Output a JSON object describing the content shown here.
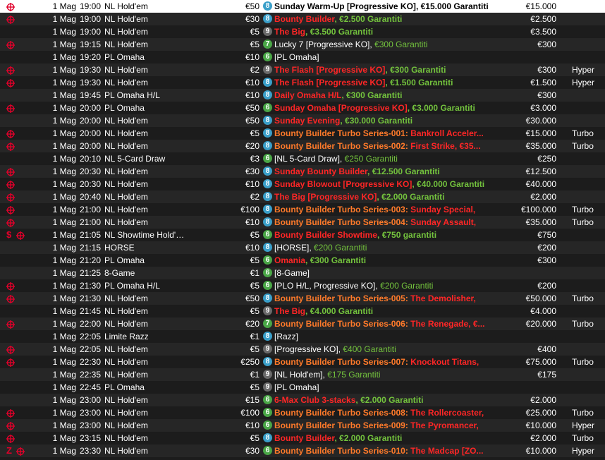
{
  "icons": {
    "target": "crosshair-target-icon",
    "dollar": "dollar-sign-icon",
    "badge": "table-size-badge"
  },
  "colors": {
    "row_alt": "#262626",
    "row_bg": "#1c1c1c",
    "selected": "#ffffff",
    "red": "#ff2626",
    "orange": "#ff7a2a",
    "green": "#73c23d",
    "badge_blue": "#3a9fc9",
    "badge_green": "#49a646",
    "badge_gray": "#6a6a6a"
  },
  "rows": [
    {
      "icons": [
        "target"
      ],
      "date": "1 Mag",
      "time": "19:00",
      "game": "NL Hold'em",
      "buyin": "€50",
      "badge": "8",
      "name": "Sunday Warm-Up [Progressive KO]",
      "tail": "",
      "gtd": "€15.000 Garantiti",
      "guarantee": "€15.000",
      "speed": "",
      "style": "selected"
    },
    {
      "icons": [
        "target"
      ],
      "date": "1 Mag",
      "time": "19:00",
      "game": "NL Hold'em",
      "buyin": "€30",
      "badge": "8",
      "name": "Bounty Builder",
      "tail": "",
      "gtd": "€2.500 Garantiti",
      "guarantee": "€2.500",
      "speed": "",
      "style": "red"
    },
    {
      "icons": [],
      "date": "1 Mag",
      "time": "19:00",
      "game": "NL Hold'em",
      "buyin": "€5",
      "badge": "9",
      "name": "The Big",
      "tail": "",
      "gtd": "€3.500 Garantiti",
      "guarantee": "€3.500",
      "speed": "",
      "style": "red"
    },
    {
      "icons": [
        "target"
      ],
      "date": "1 Mag",
      "time": "19:15",
      "game": "NL Hold'em",
      "buyin": "€5",
      "badge": "7",
      "name": "Lucky 7 [Progressive KO]",
      "tail": "",
      "gtd": "€300 Garantiti",
      "guarantee": "€300",
      "speed": "",
      "style": "white"
    },
    {
      "icons": [],
      "date": "1 Mag",
      "time": "19:20",
      "game": "PL Omaha",
      "buyin": "€10",
      "badge": "6",
      "name": "[PL Omaha]",
      "tail": "",
      "gtd": "",
      "guarantee": "",
      "speed": "",
      "style": "white"
    },
    {
      "icons": [
        "target"
      ],
      "date": "1 Mag",
      "time": "19:30",
      "game": "NL Hold'em",
      "buyin": "€2",
      "badge": "9",
      "name": "The Flash [Progressive KO]",
      "tail": "",
      "gtd": "€300 Garantiti",
      "guarantee": "€300",
      "speed": "Hyper",
      "style": "red"
    },
    {
      "icons": [
        "target"
      ],
      "date": "1 Mag",
      "time": "19:30",
      "game": "NL Hold'em",
      "buyin": "€10",
      "badge": "8",
      "name": "The Flash [Progressive KO]",
      "tail": "",
      "gtd": "€1.500 Garantiti",
      "guarantee": "€1.500",
      "speed": "Hyper",
      "style": "red"
    },
    {
      "icons": [],
      "date": "1 Mag",
      "time": "19:45",
      "game": "PL Omaha H/L",
      "buyin": "€10",
      "badge": "8",
      "name": "Daily Omaha H/L",
      "tail": "",
      "gtd": "€300 Garantiti",
      "guarantee": "€300",
      "speed": "",
      "style": "red"
    },
    {
      "icons": [
        "target"
      ],
      "date": "1 Mag",
      "time": "20:00",
      "game": "PL Omaha",
      "buyin": "€50",
      "badge": "6",
      "name": "Sunday Omaha [Progressive KO]",
      "tail": "",
      "gtd": "€3.000 Garantiti",
      "guarantee": "€3.000",
      "speed": "",
      "style": "red"
    },
    {
      "icons": [],
      "date": "1 Mag",
      "time": "20:00",
      "game": "NL Hold'em",
      "buyin": "€50",
      "badge": "8",
      "name": "Sunday Evening",
      "tail": "",
      "gtd": "€30.000 Garantiti",
      "guarantee": "€30.000",
      "speed": "",
      "style": "red"
    },
    {
      "icons": [
        "target"
      ],
      "date": "1 Mag",
      "time": "20:00",
      "game": "NL Hold'em",
      "buyin": "€5",
      "badge": "8",
      "name": "Bounty Builder Turbo Series-001:",
      "tail": " Bankroll Acceler...",
      "gtd": "",
      "guarantee": "€15.000",
      "speed": "Turbo",
      "style": "orange"
    },
    {
      "icons": [
        "target"
      ],
      "date": "1 Mag",
      "time": "20:00",
      "game": "NL Hold'em",
      "buyin": "€20",
      "badge": "8",
      "name": "Bounty Builder Turbo Series-002:",
      "tail": " First Strike, €35...",
      "gtd": "",
      "guarantee": "€35.000",
      "speed": "Turbo",
      "style": "orange"
    },
    {
      "icons": [],
      "date": "1 Mag",
      "time": "20:10",
      "game": "NL 5-Card Draw",
      "buyin": "€3",
      "badge": "6",
      "name": "[NL 5-Card Draw]",
      "tail": "",
      "gtd": "€250 Garantiti",
      "guarantee": "€250",
      "speed": "",
      "style": "white"
    },
    {
      "icons": [
        "target"
      ],
      "date": "1 Mag",
      "time": "20:30",
      "game": "NL Hold'em",
      "buyin": "€30",
      "badge": "8",
      "name": "Sunday Bounty Builder",
      "tail": "",
      "gtd": "€12.500 Garantiti",
      "guarantee": "€12.500",
      "speed": "",
      "style": "red"
    },
    {
      "icons": [
        "target"
      ],
      "date": "1 Mag",
      "time": "20:30",
      "game": "NL Hold'em",
      "buyin": "€10",
      "badge": "8",
      "name": "Sunday Blowout [Progressive KO]",
      "tail": "",
      "gtd": "€40.000 Garantiti",
      "guarantee": "€40.000",
      "speed": "",
      "style": "red"
    },
    {
      "icons": [
        "target"
      ],
      "date": "1 Mag",
      "time": "20:40",
      "game": "NL Hold'em",
      "buyin": "€2",
      "badge": "8",
      "name": "The Big [Progressive KO]",
      "tail": "",
      "gtd": "€2.000 Garantiti",
      "guarantee": "€2.000",
      "speed": "",
      "style": "red"
    },
    {
      "icons": [
        "target"
      ],
      "date": "1 Mag",
      "time": "21:00",
      "game": "NL Hold'em",
      "buyin": "€100",
      "badge": "8",
      "name": "Bounty Builder Turbo Series-003:",
      "tail": " Sunday Special,",
      "gtd": "",
      "guarantee": "€100.000",
      "speed": "Turbo",
      "style": "orange"
    },
    {
      "icons": [
        "target"
      ],
      "date": "1 Mag",
      "time": "21:00",
      "game": "NL Hold'em",
      "buyin": "€10",
      "badge": "8",
      "name": "Bounty Builder Turbo Series-004:",
      "tail": " Sunday Assault,",
      "gtd": "",
      "guarantee": "€35.000",
      "speed": "Turbo",
      "style": "orange"
    },
    {
      "icons": [
        "dollar",
        "target"
      ],
      "date": "1 Mag",
      "time": "21:05",
      "game": "NL Showtime Hold'…",
      "buyin": "€5",
      "badge": "6",
      "name": "Bounty Builder Showtime",
      "tail": "",
      "gtd": "€750 garantiti",
      "guarantee": "€750",
      "speed": "",
      "style": "red"
    },
    {
      "icons": [],
      "date": "1 Mag",
      "time": "21:15",
      "game": "HORSE",
      "buyin": "€10",
      "badge": "8",
      "name": "[HORSE]",
      "tail": "",
      "gtd": "€200 Garantiti",
      "guarantee": "€200",
      "speed": "",
      "style": "white"
    },
    {
      "icons": [],
      "date": "1 Mag",
      "time": "21:20",
      "game": "PL Omaha",
      "buyin": "€5",
      "badge": "6",
      "name": "Omania",
      "tail": "",
      "gtd": "€300 Garantiti",
      "guarantee": "€300",
      "speed": "",
      "style": "red"
    },
    {
      "icons": [],
      "date": "1 Mag",
      "time": "21:25",
      "game": "8-Game",
      "buyin": "€1",
      "badge": "6",
      "name": "[8-Game]",
      "tail": "",
      "gtd": "",
      "guarantee": "",
      "speed": "",
      "style": "white"
    },
    {
      "icons": [
        "target"
      ],
      "date": "1 Mag",
      "time": "21:30",
      "game": "PL Omaha H/L",
      "buyin": "€5",
      "badge": "6",
      "name": "[PLO H/L, Progressive KO]",
      "tail": "",
      "gtd": "€200 Garantiti",
      "guarantee": "€200",
      "speed": "",
      "style": "white"
    },
    {
      "icons": [
        "target"
      ],
      "date": "1 Mag",
      "time": "21:30",
      "game": "NL Hold'em",
      "buyin": "€50",
      "badge": "8",
      "name": "Bounty Builder Turbo Series-005:",
      "tail": " The Demolisher,",
      "gtd": "",
      "guarantee": "€50.000",
      "speed": "Turbo",
      "style": "orange"
    },
    {
      "icons": [],
      "date": "1 Mag",
      "time": "21:45",
      "game": "NL Hold'em",
      "buyin": "€5",
      "badge": "9",
      "name": "The Big",
      "tail": "",
      "gtd": "€4.000 Garantiti",
      "guarantee": "€4.000",
      "speed": "",
      "style": "red"
    },
    {
      "icons": [
        "target"
      ],
      "date": "1 Mag",
      "time": "22:00",
      "game": "NL Hold'em",
      "buyin": "€20",
      "badge": "7",
      "name": "Bounty Builder Turbo Series-006:",
      "tail": " The Renegade, €...",
      "gtd": "",
      "guarantee": "€20.000",
      "speed": "Turbo",
      "style": "orange"
    },
    {
      "icons": [],
      "date": "1 Mag",
      "time": "22:05",
      "game": "Limite Razz",
      "buyin": "€1",
      "badge": "8",
      "name": "[Razz]",
      "tail": "",
      "gtd": "",
      "guarantee": "",
      "speed": "",
      "style": "white"
    },
    {
      "icons": [
        "target"
      ],
      "date": "1 Mag",
      "time": "22:05",
      "game": "NL Hold'em",
      "buyin": "€5",
      "badge": "9",
      "name": "[Progressive KO]",
      "tail": "",
      "gtd": "€400 Garantiti",
      "guarantee": "€400",
      "speed": "",
      "style": "white"
    },
    {
      "icons": [
        "target"
      ],
      "date": "1 Mag",
      "time": "22:30",
      "game": "NL Hold'em",
      "buyin": "€250",
      "badge": "8",
      "name": "Bounty Builder Turbo Series-007:",
      "tail": " Knockout Titans,",
      "gtd": "",
      "guarantee": "€75.000",
      "speed": "Turbo",
      "style": "orange"
    },
    {
      "icons": [],
      "date": "1 Mag",
      "time": "22:35",
      "game": "NL Hold'em",
      "buyin": "€1",
      "badge": "9",
      "name": "[NL Hold'em]",
      "tail": "",
      "gtd": "€175 Garantiti",
      "guarantee": "€175",
      "speed": "",
      "style": "white"
    },
    {
      "icons": [],
      "date": "1 Mag",
      "time": "22:45",
      "game": "PL Omaha",
      "buyin": "€5",
      "badge": "9",
      "name": "[PL Omaha]",
      "tail": "",
      "gtd": "",
      "guarantee": "",
      "speed": "",
      "style": "white"
    },
    {
      "icons": [],
      "date": "1 Mag",
      "time": "23:00",
      "game": "NL Hold'em",
      "buyin": "€15",
      "badge": "6",
      "name": "6-Max Club 3-stacks",
      "tail": "",
      "gtd": "€2.000 Garantiti",
      "guarantee": "€2.000",
      "speed": "",
      "style": "red"
    },
    {
      "icons": [
        "target"
      ],
      "date": "1 Mag",
      "time": "23:00",
      "game": "NL Hold'em",
      "buyin": "€100",
      "badge": "6",
      "name": "Bounty Builder Turbo Series-008:",
      "tail": " The Rollercoaster,",
      "gtd": "",
      "guarantee": "€25.000",
      "speed": "Turbo",
      "style": "orange"
    },
    {
      "icons": [
        "target"
      ],
      "date": "1 Mag",
      "time": "23:00",
      "game": "NL Hold'em",
      "buyin": "€10",
      "badge": "6",
      "name": "Bounty Builder Turbo Series-009:",
      "tail": " The Pyromancer,",
      "gtd": "",
      "guarantee": "€10.000",
      "speed": "Hyper",
      "style": "orange"
    },
    {
      "icons": [
        "target"
      ],
      "date": "1 Mag",
      "time": "23:15",
      "game": "NL Hold'em",
      "buyin": "€5",
      "badge": "8",
      "name": "Bounty Builder",
      "tail": "",
      "gtd": "€2.000 Garantiti",
      "guarantee": "€2.000",
      "speed": "Turbo",
      "style": "red"
    },
    {
      "icons": [
        "z",
        "target"
      ],
      "date": "1 Mag",
      "time": "23:30",
      "game": "NL Hold'em",
      "buyin": "€30",
      "badge": "6",
      "name": "Bounty Builder Turbo Series-010:",
      "tail": " The Madcap [ZO...",
      "gtd": "",
      "guarantee": "€10.000",
      "speed": "Hyper",
      "style": "orange"
    }
  ]
}
